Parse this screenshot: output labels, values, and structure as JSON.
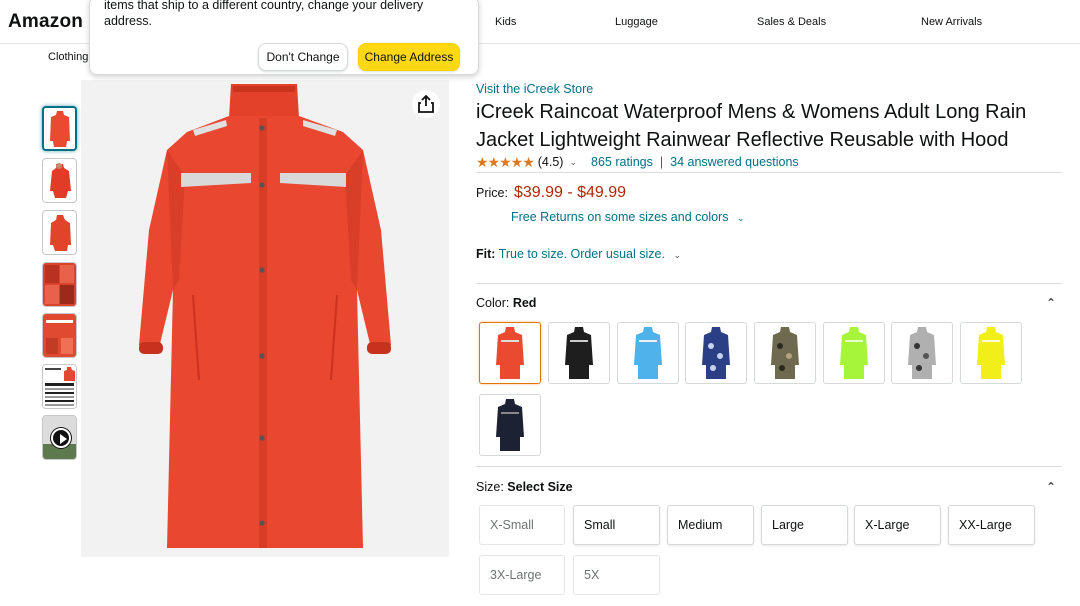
{
  "nav": {
    "brand": "Amazon",
    "links": [
      "Kids",
      "Luggage",
      "Sales & Deals",
      "New Arrivals"
    ],
    "subnav_item": "Clothing"
  },
  "popover": {
    "text": "items that ship to a different country, change your delivery address.",
    "dont_change": "Don't Change",
    "change_address": "Change Address"
  },
  "product": {
    "store_link": "Visit the iCreek Store",
    "title": "iCreek Raincoat Waterproof Mens & Womens Adult Long Rain Jacket Lightweight Rainwear Reflective Reusable with Hood",
    "rating_stars": "★★★★★",
    "rating_value": "(4.5)",
    "ratings_count": "865 ratings",
    "separator": "|",
    "answered": "34 answered questions",
    "price_label": "Price:",
    "price": "$39.99 - $49.99",
    "returns": "Free Returns on some sizes and colors",
    "fit_label": "Fit:",
    "fit_value": "True to size. Order usual size.",
    "color_label": "Color:",
    "color_value": "Red",
    "size_label": "Size:",
    "size_value": "Select Size"
  },
  "colors": {
    "accent_link": "#007185",
    "price": "#B12704",
    "button_yellow": "#FFD814",
    "swatches": [
      "#ea4a2f",
      "#1e1e1e",
      "#4fb2ea",
      "#2a3f86",
      "#6e6a50",
      "#a6f53a",
      "#b0b0b0",
      "#f2ee1a",
      "#1c2233"
    ]
  },
  "sizes": [
    {
      "label": "X-Small",
      "available": false
    },
    {
      "label": "Small",
      "available": true
    },
    {
      "label": "Medium",
      "available": true
    },
    {
      "label": "Large",
      "available": true
    },
    {
      "label": "X-Large",
      "available": true
    },
    {
      "label": "XX-Large",
      "available": true
    },
    {
      "label": "3X-Large",
      "available": false
    },
    {
      "label": "5X",
      "available": false
    }
  ],
  "icons": {
    "share": "share-icon",
    "collapse": "chevron-up-icon",
    "dropdown": "chevron-down-icon",
    "play": "play-icon"
  }
}
